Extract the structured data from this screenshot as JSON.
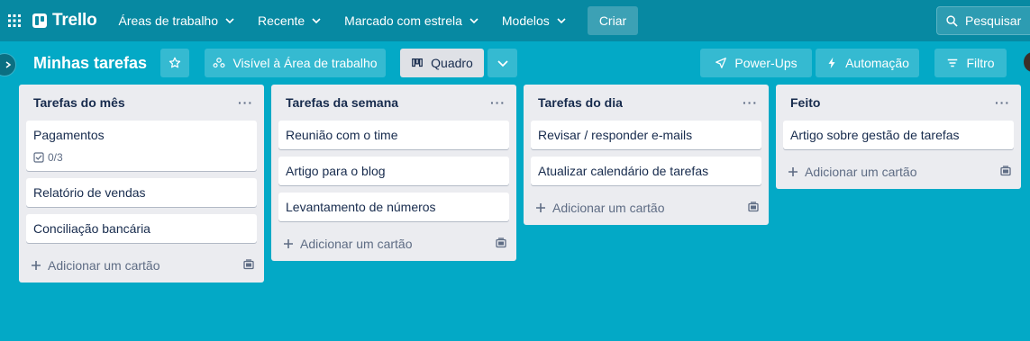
{
  "nav": {
    "brand": "Trello",
    "items": [
      {
        "label": "Áreas de trabalho"
      },
      {
        "label": "Recente"
      },
      {
        "label": "Marcado com estrela"
      },
      {
        "label": "Modelos"
      }
    ],
    "create_label": "Criar",
    "search_placeholder": "Pesquisar"
  },
  "board": {
    "title": "Minhas tarefas",
    "visibility_label": "Visível à Área de trabalho",
    "view_label": "Quadro",
    "powerups_label": "Power-Ups",
    "automation_label": "Automação",
    "filter_label": "Filtro"
  },
  "add_card_label": "Adicionar um cartão",
  "lists": [
    {
      "title": "Tarefas do mês",
      "cards": [
        {
          "title": "Pagamentos",
          "checklist": "0/3"
        },
        {
          "title": "Relatório de vendas"
        },
        {
          "title": "Conciliação bancária"
        }
      ]
    },
    {
      "title": "Tarefas da semana",
      "cards": [
        {
          "title": "Reunião com o time"
        },
        {
          "title": "Artigo para o blog"
        },
        {
          "title": "Levantamento de números"
        }
      ]
    },
    {
      "title": "Tarefas do dia",
      "cards": [
        {
          "title": "Revisar / responder e-mails"
        },
        {
          "title": "Atualizar calendário de tarefas"
        }
      ]
    },
    {
      "title": "Feito",
      "cards": [
        {
          "title": "Artigo sobre gestão de tarefas"
        }
      ]
    }
  ],
  "colors": {
    "board_background": "#03a9c6",
    "nav_background": "#0789a2",
    "list_background": "#ebecf0"
  }
}
